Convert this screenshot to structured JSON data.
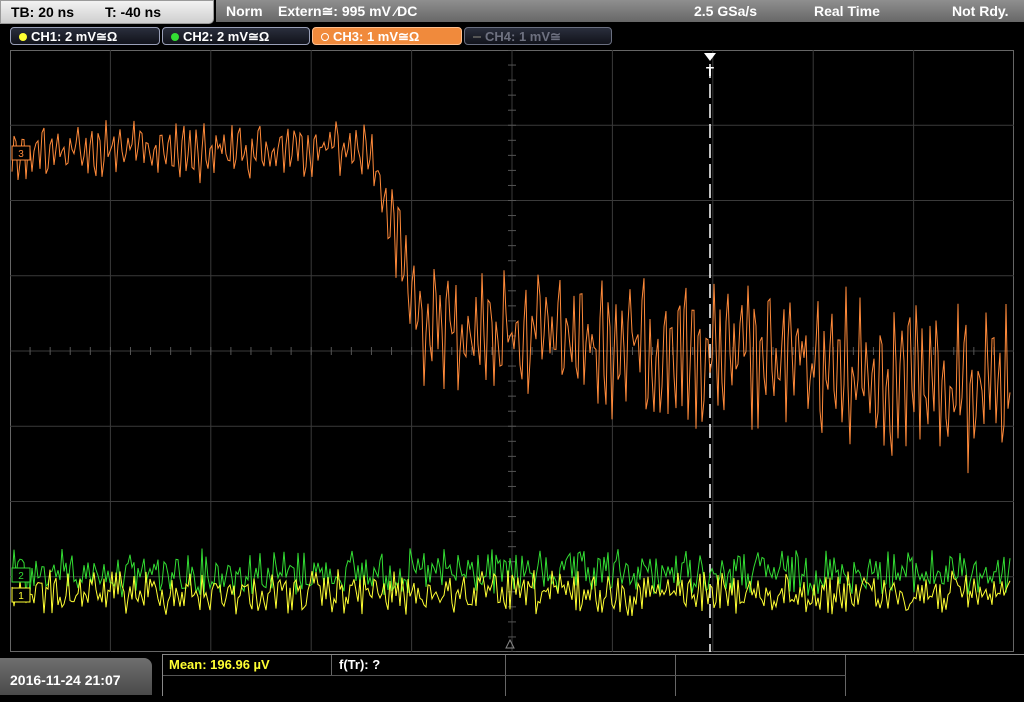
{
  "timebase": {
    "tb": "TB: 20 ns",
    "trigger_offset": "T: -40 ns"
  },
  "trigger": {
    "mode": "Norm",
    "source": "Extern≅: 995 mV ⁄DC",
    "sample_rate": "2.5 GSa/s",
    "acquisition": "Real Time",
    "status": "Not Rdy."
  },
  "channels": [
    {
      "label": "CH1: 2 mV≅Ω",
      "color": "#ffff33"
    },
    {
      "label": "CH2: 2 mV≅Ω",
      "color": "#33dd33"
    },
    {
      "label": "CH3: 1 mV≅Ω",
      "color": "#ff8a3a"
    },
    {
      "label": "CH4: 1 mV≅",
      "color": "#555555"
    }
  ],
  "trigger_marker": "T",
  "footer": {
    "datetime": "2016-11-24 21:07",
    "mean": "Mean: 196.96 µV",
    "freq": "f(Tr): ?"
  },
  "colors": {
    "grid": "#3a3a3a",
    "ch1": "#ffff33",
    "ch2": "#33dd33",
    "ch3": "#ff8a3a",
    "trigger_line": "#ffffff"
  }
}
